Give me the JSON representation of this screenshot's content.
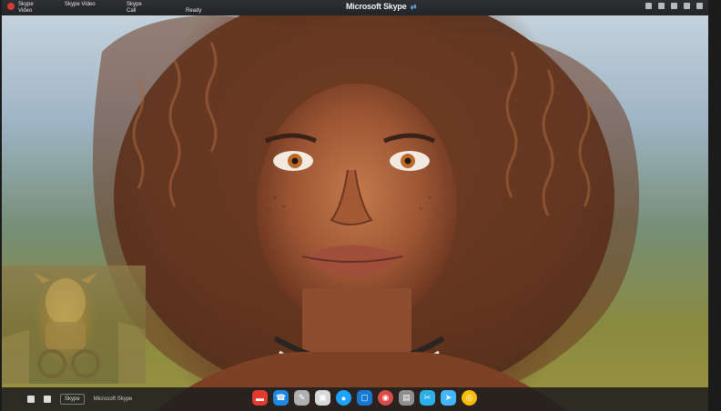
{
  "window": {
    "title": "Microsoft Skype",
    "tabs": [
      "Microsoft Skype",
      "Skype Video"
    ],
    "left_tab_lines": [
      "Skype",
      "Video"
    ],
    "mid_tab_lines": [
      "Skype",
      "Call"
    ],
    "status": "Ready"
  },
  "bottom": {
    "chip": "Skype",
    "label": "Microsoft Skype"
  },
  "dock_apps": [
    {
      "name": "red-app-icon",
      "color": "#e23b2e",
      "glyph": "▬"
    },
    {
      "name": "skype-call-icon",
      "color": "#1e88e5",
      "glyph": "☎"
    },
    {
      "name": "tools-icon",
      "color": "#b0b0b0",
      "glyph": "✎"
    },
    {
      "name": "chat-icon",
      "color": "#d8d8d8",
      "glyph": "▣"
    },
    {
      "name": "blue-dot-icon",
      "color": "#1fa3ff",
      "glyph": "●"
    },
    {
      "name": "window-icon",
      "color": "#1778d6",
      "glyph": "▢"
    },
    {
      "name": "record-icon",
      "color": "#d94a4a",
      "glyph": "◉"
    },
    {
      "name": "file-icon",
      "color": "#8f8f8f",
      "glyph": "▤"
    },
    {
      "name": "scissors-icon",
      "color": "#2bb0e8",
      "glyph": "✂"
    },
    {
      "name": "send-icon",
      "color": "#42b7ff",
      "glyph": "➤"
    },
    {
      "name": "chrome-icon",
      "color": "#fbbc05",
      "glyph": "◎"
    }
  ]
}
